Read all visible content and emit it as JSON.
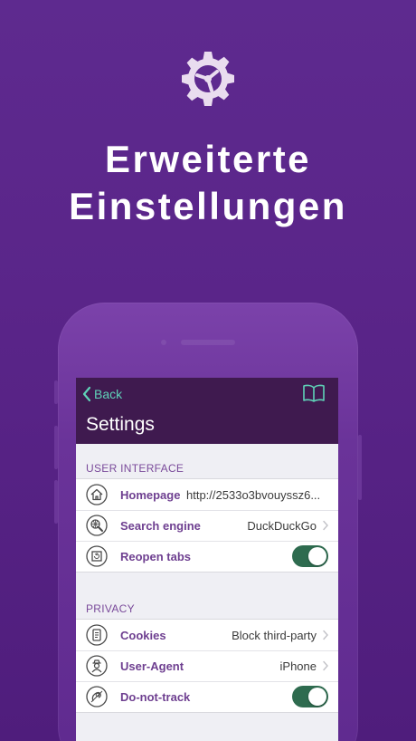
{
  "hero": {
    "icon": "gear-icon",
    "title_line1": "Erweiterte",
    "title_line2": "Einstellungen"
  },
  "navbar": {
    "back_label": "Back",
    "title": "Settings",
    "bookmark_icon": "book-icon"
  },
  "sections": [
    {
      "header": "USER INTERFACE",
      "rows": [
        {
          "label": "Homepage",
          "value": "http://2533o3bvouyssz6...",
          "icon": "home-icon",
          "accessory": "none"
        },
        {
          "label": "Search engine",
          "value": "DuckDuckGo",
          "icon": "search-globe-icon",
          "accessory": "chevron"
        },
        {
          "label": "Reopen tabs",
          "value": "",
          "icon": "tabs-icon",
          "accessory": "toggle",
          "on": true
        }
      ]
    },
    {
      "header": "PRIVACY",
      "rows": [
        {
          "label": "Cookies",
          "value": "Block third-party",
          "icon": "cookie-document-icon",
          "accessory": "chevron"
        },
        {
          "label": "User-Agent",
          "value": "iPhone",
          "icon": "agent-icon",
          "accessory": "chevron"
        },
        {
          "label": "Do-not-track",
          "value": "",
          "icon": "do-not-track-icon",
          "accessory": "toggle",
          "on": true
        }
      ]
    }
  ],
  "colors": {
    "background": "#5a2589",
    "navbar": "#3f1a4f",
    "accent": "#5fd3b8",
    "label": "#6e3f90",
    "toggle_on": "#2e6b4f"
  }
}
